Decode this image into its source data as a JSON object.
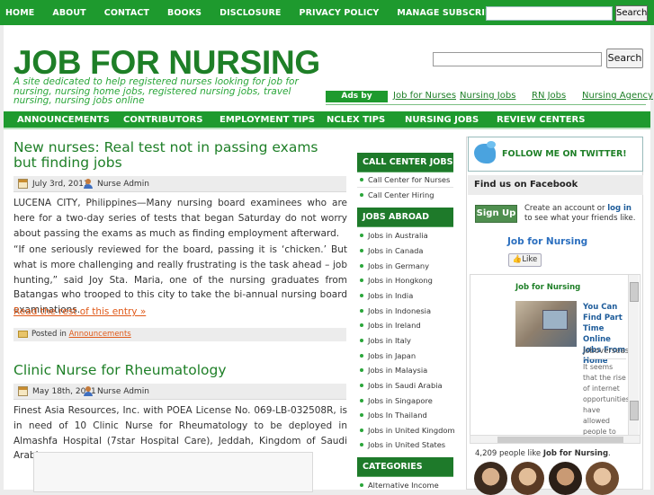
{
  "topnav": {
    "items": [
      "HOME",
      "ABOUT",
      "CONTACT",
      "BOOKS",
      "DISCLOSURE",
      "PRIVACY POLICY",
      "MANAGE SUBSCRIPTIONS"
    ],
    "search_button": "Search"
  },
  "header": {
    "title": "JOB FOR NURSING",
    "tagline": "A site dedicated to help registered nurses looking for job for nursing, nursing home jobs, registered nursing jobs, travel nursing, nursing jobs online",
    "search_button": "Search"
  },
  "ads": {
    "badge": "Ads by Google",
    "links": [
      "Job for Nurses",
      "Nursing Jobs",
      "RN Jobs",
      "Nursing Agency"
    ]
  },
  "catnav": {
    "items": [
      "ANNOUNCEMENTS",
      "CONTRIBUTORS",
      "EMPLOYMENT TIPS",
      "NCLEX TIPS",
      "NURSING JOBS",
      "REVIEW CENTERS"
    ]
  },
  "posts": [
    {
      "title": "New nurses: Real test not in passing exams but finding jobs",
      "date": "July 3rd, 2011",
      "author": "Nurse Admin",
      "paragraphs": [
        "LUCENA CITY, Philippines—Many nursing board examinees who are here for a two-day series of tests that began Saturday do not worry about passing the exams as much as finding employment afterward.",
        "“If one seriously reviewed for the board, passing it is ‘chicken.’ But what is more challenging and really frustrating is the task ahead – job hunting,” said Joy Sta. Maria, one of the nursing graduates from Batangas who trooped to this city to take the bi-annual nursing board examinations."
      ],
      "read_more": "Read the rest of this entry »",
      "posted_in": "Posted in",
      "category": "Announcements"
    },
    {
      "title": "Clinic Nurse for Rheumatology",
      "date": "May 18th, 2011",
      "author": "Nurse Admin",
      "paragraphs": [
        "Finest Asia Resources, Inc. with POEA License No. 069-LB-032508R, is in need of 10 Clinic Nurse for Rheumatology to be deployed in Almashfa Hospital (7star Hospital Care), Jeddah, Kingdom of Saudi Arabia."
      ]
    }
  ],
  "middle_sidebar": {
    "call_center": {
      "heading": "CALL CENTER JOBS",
      "items": [
        "Call Center for Nurses",
        "Call Center Hiring"
      ]
    },
    "jobs_abroad": {
      "heading": "JOBS ABROAD",
      "items": [
        "Jobs in Australia",
        "Jobs in Canada",
        "Jobs in Germany",
        "Jobs in Hongkong",
        "Jobs in India",
        "Jobs in Indonesia",
        "Jobs in Ireland",
        "Jobs in Italy",
        "Jobs in Japan",
        "Jobs in Malaysia",
        "Jobs in Saudi Arabia",
        "Jobs in Singapore",
        "Jobs In Thailand",
        "Jobs in United Kingdom",
        "Jobs in United States"
      ]
    },
    "categories": {
      "heading": "CATEGORIES",
      "items": [
        "Alternative Income"
      ]
    }
  },
  "right_sidebar": {
    "twitter": "FOLLOW ME ON TWITTER!",
    "facebook": {
      "heading": "Find us on Facebook",
      "signup": "Sign Up",
      "note_prefix": "Create an account or ",
      "note_login": "log in",
      "note_suffix": " to see what your friends like.",
      "page_name": "Job for Nursing",
      "like": "Like",
      "inner_title": "Job for Nursing",
      "post_title": "You Can Find Part Time Online Jobs From Home",
      "post_source": "joboverseas.",
      "post_desc": "It seems that the rise of internet opportunities have allowed people to recover from",
      "count_prefix": "4,209 people like ",
      "count_page": "Job for Nursing",
      "count_suffix": "."
    }
  }
}
